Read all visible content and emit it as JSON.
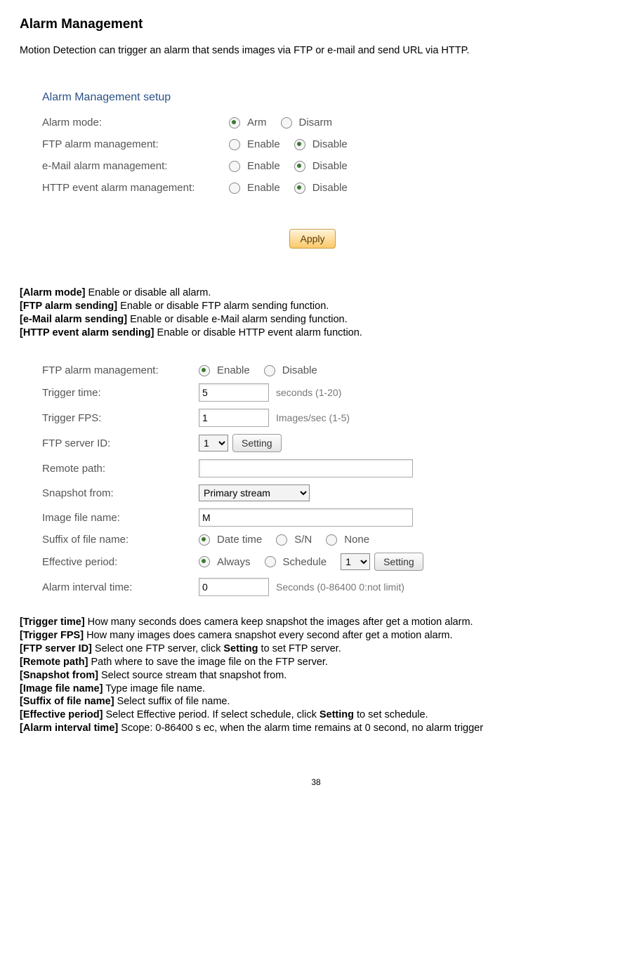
{
  "page": {
    "title": "Alarm Management",
    "intro": "Motion Detection can trigger an alarm that sends images via FTP or e-mail and send URL via HTTP.",
    "number": "38"
  },
  "panel1": {
    "title": "Alarm Management setup",
    "rows": {
      "alarm_mode": {
        "label": "Alarm mode:",
        "opt1": "Arm",
        "opt2": "Disarm"
      },
      "ftp": {
        "label": "FTP alarm management:",
        "opt1": "Enable",
        "opt2": "Disable"
      },
      "email": {
        "label": "e-Mail alarm management:",
        "opt1": "Enable",
        "opt2": "Disable"
      },
      "http": {
        "label": "HTTP event alarm management:",
        "opt1": "Enable",
        "opt2": "Disable"
      }
    },
    "apply": "Apply"
  },
  "desc1": {
    "l1b": "[Alarm mode]",
    "l1t": " Enable or disable all alarm.",
    "l2b": "[FTP alarm sending]",
    "l2t": " Enable or disable FTP alarm sending function.",
    "l3b": "[e-Mail alarm sending]",
    "l3t": " Enable or disable e-Mail alarm sending function.",
    "l4b": "[HTTP event alarm sending]",
    "l4t": " Enable or disable HTTP event alarm function."
  },
  "panel2": {
    "ftp_mgmt": {
      "label": "FTP alarm management:",
      "opt1": "Enable",
      "opt2": "Disable"
    },
    "trigger_time": {
      "label": "Trigger time:",
      "value": "5",
      "hint": "seconds (1-20)"
    },
    "trigger_fps": {
      "label": "Trigger FPS:",
      "value": "1",
      "hint": "Images/sec (1-5)"
    },
    "ftp_server_id": {
      "label": "FTP server ID:",
      "value": "1",
      "btn": "Setting"
    },
    "remote_path": {
      "label": "Remote path:",
      "value": ""
    },
    "snapshot_from": {
      "label": "Snapshot from:",
      "value": "Primary stream"
    },
    "image_file_name": {
      "label": "Image file name:",
      "value": "M"
    },
    "suffix": {
      "label": "Suffix of file name:",
      "opt1": "Date time",
      "opt2": "S/N",
      "opt3": "None"
    },
    "effective": {
      "label": "Effective period:",
      "opt1": "Always",
      "opt2": "Schedule",
      "sel": "1",
      "btn": "Setting"
    },
    "interval": {
      "label": "Alarm interval time:",
      "value": "0",
      "hint": "Seconds (0-86400 0:not limit)"
    }
  },
  "desc2": {
    "l1b": "[Trigger time]",
    "l1t": " How many seconds does camera keep snapshot the images after get a motion alarm.",
    "l2b": "[Trigger FPS]",
    "l2t": " How many images does camera snapshot every second after get a motion alarm.",
    "l3b": "[FTP server ID]",
    "l3t1": " Select one FTP server, click ",
    "l3t2": "Setting",
    "l3t3": " to set FTP server.",
    "l4b": "[Remote path]",
    "l4t": " Path where to save the image file on the FTP server.",
    "l5b": "[Snapshot from]",
    "l5t": " Select source stream that snapshot from.",
    "l6b": "[Image file name]",
    "l6t": " Type image file name.",
    "l7b": "[Suffix of file name]",
    "l7t": " Select suffix of file name.",
    "l8b": "[Effective period]",
    "l8t1": " Select Effective period. If select schedule, click ",
    "l8t2": "Setting",
    "l8t3": " to set schedule.",
    "l9b": "[Alarm interval time]",
    "l9t": " Scope: 0-86400 s ec, when the alarm time remains at 0 second, no alarm trigger"
  }
}
